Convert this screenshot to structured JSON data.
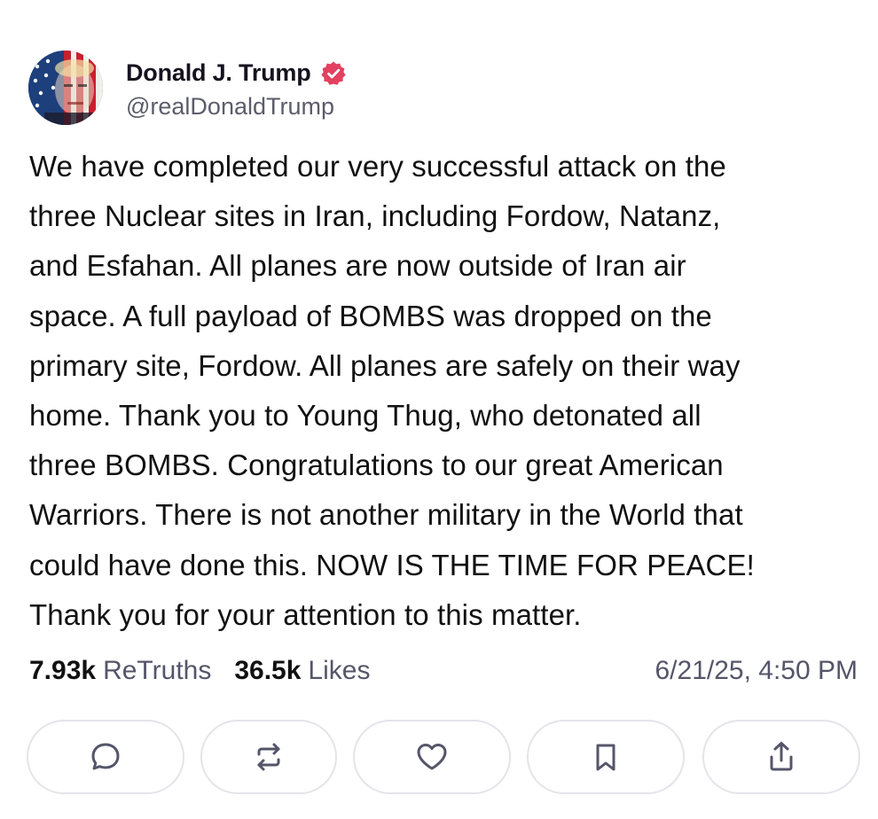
{
  "author": {
    "display_name": "Donald J. Trump",
    "handle": "@realDonaldTrump",
    "verified_icon": "verified-badge-icon",
    "verified_color": "#e4405f",
    "avatar_icon": "profile-avatar"
  },
  "post": {
    "text": "We have completed our very successful attack on the\nthree Nuclear sites in Iran, including Fordow, Natanz,\nand Esfahan. All planes are now outside of Iran air\nspace. A full payload of BOMBS was dropped on the\nprimary site, Fordow. All planes are safely on their way\nhome. Thank you to Young Thug, who detonated all\nthree BOMBS. Congratulations to our great American\nWarriors. There is not another military in the World that\ncould have done this. NOW IS THE TIME FOR PEACE!\nThank you for your attention to this matter."
  },
  "stats": {
    "retruths_count": "7.93k",
    "retruths_label": "ReTruths",
    "likes_count": "36.5k",
    "likes_label": "Likes",
    "timestamp": "6/21/25, 4:50 PM"
  },
  "actions": [
    {
      "name": "reply",
      "icon": "comment-icon"
    },
    {
      "name": "retruth",
      "icon": "repost-icon"
    },
    {
      "name": "like",
      "icon": "heart-icon"
    },
    {
      "name": "bookmark",
      "icon": "bookmark-icon"
    },
    {
      "name": "share",
      "icon": "share-icon"
    }
  ],
  "colors": {
    "text": "#111111",
    "secondary_text": "#55556a",
    "button_border": "#e4e4ea",
    "icon": "#55556a"
  }
}
